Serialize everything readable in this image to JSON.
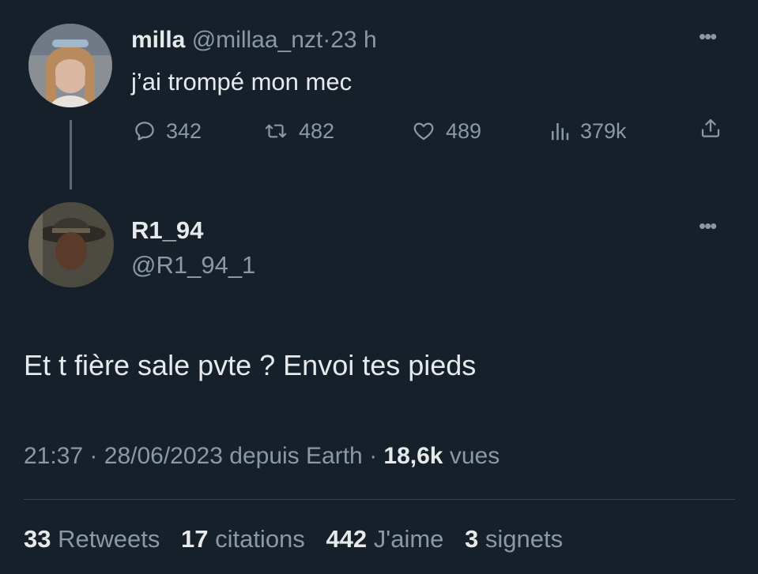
{
  "colors": {
    "background": "#15202b",
    "text_primary": "#e7e9ea",
    "text_secondary": "#8b98a5",
    "divider": "#38444d"
  },
  "tweet1": {
    "name": "milla",
    "handle": "@millaa_nzt",
    "separator": "·",
    "time": "23 h",
    "text": "j’ai trompé mon mec",
    "more_icon": "more-horizontal-icon",
    "actions": {
      "reply": {
        "icon": "reply-bubble-icon",
        "count": "342"
      },
      "retweet": {
        "icon": "retweet-icon",
        "count": "482"
      },
      "like": {
        "icon": "heart-icon",
        "count": "489"
      },
      "views": {
        "icon": "views-bar-chart-icon",
        "count": "379k"
      },
      "share": {
        "icon": "share-upload-icon"
      }
    }
  },
  "tweet2": {
    "name": "R1_94",
    "handle": "@R1_94_1",
    "more_icon": "more-horizontal-icon",
    "text": "Et t fière sale pvte ? Envoi tes pieds",
    "meta": {
      "time": "21:37",
      "separator1": "·",
      "date": "28/06/2023",
      "source": "depuis Earth",
      "separator2": "·",
      "views_count": "18,6k",
      "views_label": "vues"
    },
    "stats": [
      {
        "count": "33",
        "label": "Retweets"
      },
      {
        "count": "17",
        "label": "citations"
      },
      {
        "count": "442",
        "label": "J'aime"
      },
      {
        "count": "3",
        "label": "signets"
      }
    ]
  }
}
